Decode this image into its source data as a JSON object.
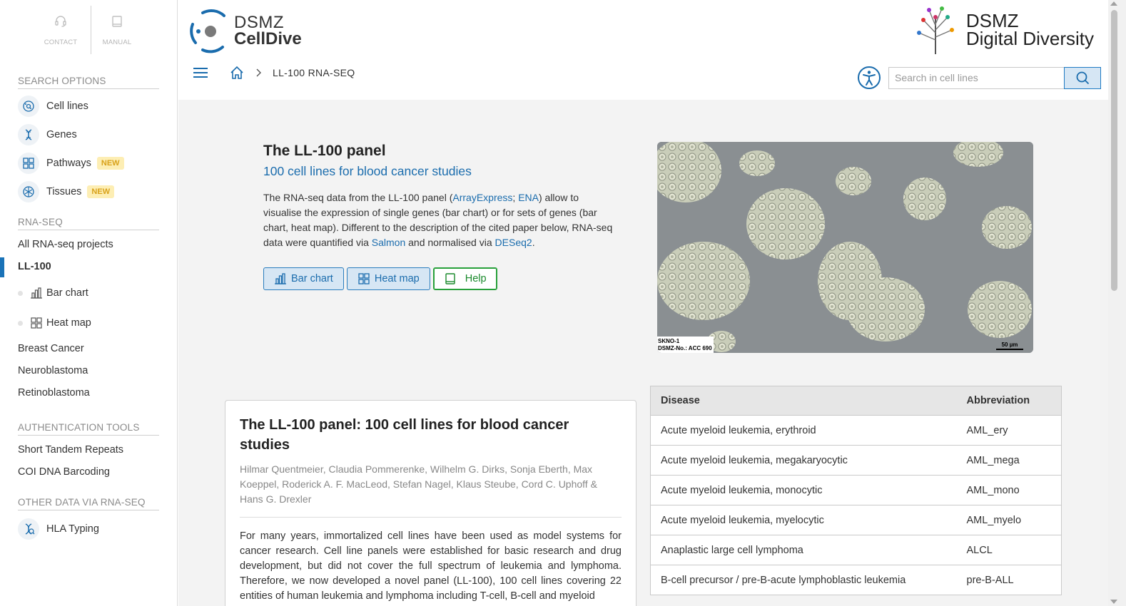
{
  "sidebar": {
    "top_links": [
      {
        "label": "CONTACT",
        "icon": "headset-icon"
      },
      {
        "label": "MANUAL",
        "icon": "book-icon"
      }
    ],
    "search_options_heading": "SEARCH OPTIONS",
    "search_options": [
      {
        "label": "Cell lines",
        "icon": "cell-icon",
        "badge": ""
      },
      {
        "label": "Genes",
        "icon": "dna-icon",
        "badge": ""
      },
      {
        "label": "Pathways",
        "icon": "pathway-icon",
        "badge": "NEW"
      },
      {
        "label": "Tissues",
        "icon": "tissue-icon",
        "badge": "NEW"
      }
    ],
    "rnaseq_heading": "RNA-SEQ",
    "rnaseq_items": [
      {
        "label": "All RNA-seq projects"
      },
      {
        "label": "LL-100"
      },
      {
        "label": "Bar chart"
      },
      {
        "label": "Heat map"
      },
      {
        "label": "Breast Cancer"
      },
      {
        "label": "Neuroblastoma"
      },
      {
        "label": "Retinoblastoma"
      }
    ],
    "auth_heading": "AUTHENTICATION TOOLS",
    "auth_items": [
      {
        "label": "Short Tandem Repeats"
      },
      {
        "label": "COI DNA Barcoding"
      }
    ],
    "other_heading": "OTHER DATA VIA RNA-SEQ",
    "other_items": [
      {
        "label": "HLA Typing",
        "icon": "hla-icon"
      }
    ]
  },
  "header": {
    "brand_line1": "DSMZ",
    "brand_line2": "CellDive",
    "dd_line1": "DSMZ",
    "dd_line2": "Digital Diversity",
    "breadcrumb": "LL-100 RNA-SEQ",
    "search_placeholder": "Search in cell lines"
  },
  "intro": {
    "title": "The LL-100 panel",
    "subtitle": "100 cell lines for blood cancer studies",
    "text_1": "The RNA-seq data from the LL-100 panel (",
    "link_arrayexpress": "ArrayExpress",
    "text_sep": "; ",
    "link_ena": "ENA",
    "text_2": ") allow to visualise the expression of single genes (bar chart) or for sets of genes (bar chart, heat map). Different to the description of the cited paper below, RNA-seq data were quantified via ",
    "link_salmon": "Salmon",
    "text_3": " and normalised via ",
    "link_deseq": "DESeq2",
    "text_4": ".",
    "buttons": {
      "bar_chart": "Bar chart",
      "heat_map": "Heat map",
      "help": "Help"
    }
  },
  "image": {
    "caption_line1": "SKNO-1",
    "caption_line2": "DSMZ-No.: ACC 690",
    "scale_label": "50 µm"
  },
  "paper": {
    "title": "The LL-100 panel: 100 cell lines for blood cancer studies",
    "authors": "Hilmar Quentmeier, Claudia Pommerenke, Wilhelm G. Dirks, Sonja Eberth, Max Koeppel, Roderick A. F. MacLeod, Stefan Nagel, Klaus Steube, Cord C. Uphoff & Hans G. Drexler",
    "abstract": "For many years, immortalized cell lines have been used as model systems for cancer research. Cell line panels were established for basic research and drug development, but did not cover the full spectrum of leukemia and lymphoma. Therefore, we now developed a novel panel (LL-100), 100 cell lines covering 22 entities of human leukemia and lymphoma including T-cell, B-cell and myeloid"
  },
  "disease_table": {
    "headers": [
      "Disease",
      "Abbreviation"
    ],
    "rows": [
      [
        "Acute myeloid leukemia, erythroid",
        "AML_ery"
      ],
      [
        "Acute myeloid leukemia, megakaryocytic",
        "AML_mega"
      ],
      [
        "Acute myeloid leukemia, monocytic",
        "AML_mono"
      ],
      [
        "Acute myeloid leukemia, myelocytic",
        "AML_myelo"
      ],
      [
        "Anaplastic large cell lymphoma",
        "ALCL"
      ],
      [
        "B-cell precursor / pre-B-acute lymphoblastic leukemia",
        "pre-B-ALL"
      ]
    ]
  },
  "colors": {
    "accent": "#1a6cad",
    "badge_bg": "#fdeeb4",
    "badge_text": "#d9a21b",
    "help_green": "#27a03a"
  }
}
